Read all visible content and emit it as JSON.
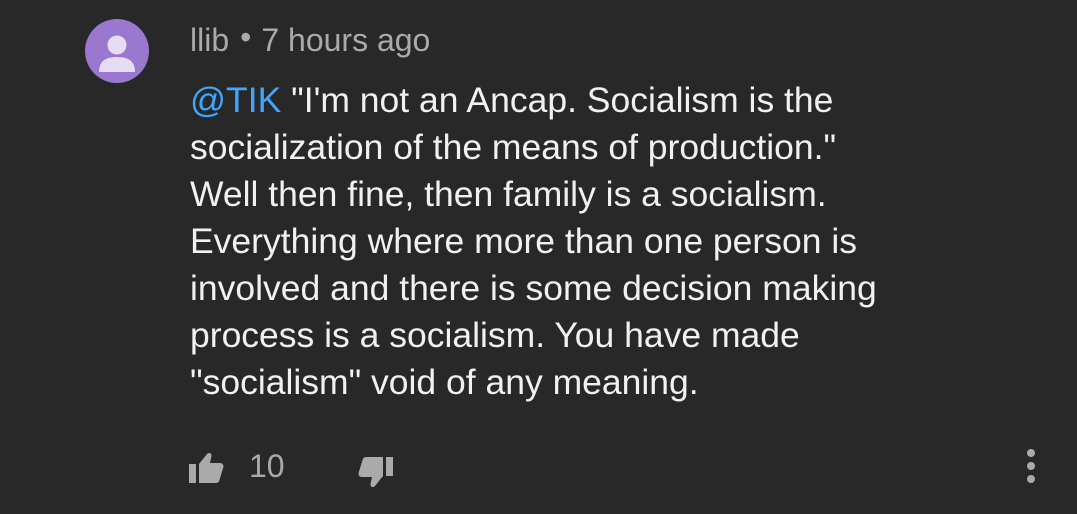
{
  "comment": {
    "author": "llib",
    "separator": "•",
    "timestamp": "7 hours ago",
    "mention": "@TIK",
    "body_lines": [
      " \"I'm not an Ancap. Socialism is the",
      "socialization of the means of production.\"",
      "Well then fine, then family is a socialism.",
      "Everything where more than one person is",
      "involved and there is some decision making",
      "process is a socialism. You have made",
      "\"socialism\" void of any meaning."
    ],
    "like_count": "10"
  },
  "icons": {
    "avatar": "default-user-avatar",
    "like": "thumbs-up-icon",
    "dislike": "thumbs-down-icon",
    "more": "vertical-ellipsis-icon"
  },
  "colors": {
    "background": "#282828",
    "text": "#f1f1f1",
    "secondary_text": "#aaaaaa",
    "mention": "#3ea6ff",
    "avatar_bg": "#9b78cf"
  }
}
